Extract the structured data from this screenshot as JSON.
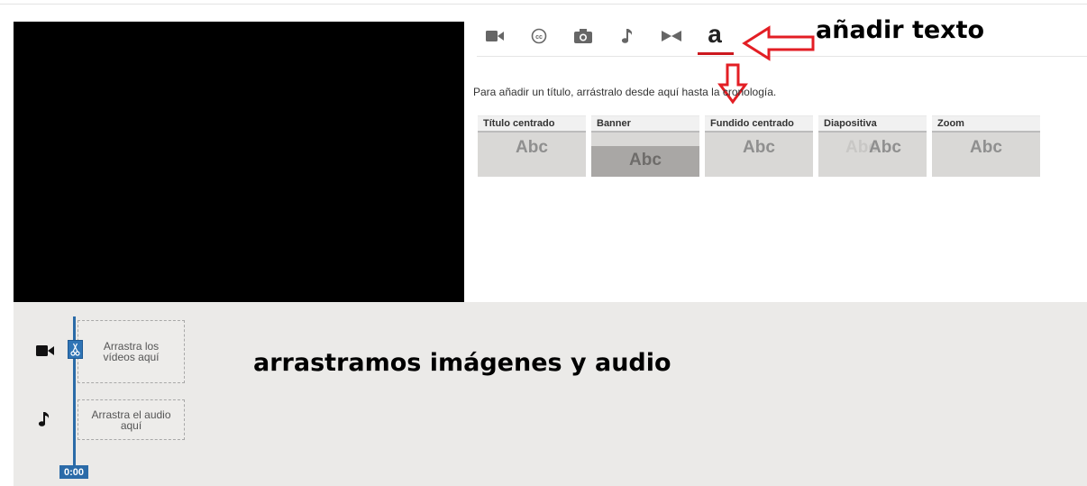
{
  "editor": {
    "tabs": [
      {
        "name": "video-camera-icon"
      },
      {
        "name": "closed-captions-icon"
      },
      {
        "name": "photo-camera-icon"
      },
      {
        "name": "music-note-icon"
      },
      {
        "name": "transitions-icon"
      },
      {
        "name": "text-tab",
        "label": "a"
      }
    ],
    "instruction": "Para añadir un título, arrástralo desde aquí hasta la cronología.",
    "title_styles": [
      {
        "label": "Título centrado",
        "sample": "Abc"
      },
      {
        "label": "Banner",
        "sample": "Abc"
      },
      {
        "label": "Fundido centrado",
        "sample": "Abc"
      },
      {
        "label": "Diapositiva",
        "sample": "Abc"
      },
      {
        "label": "Zoom",
        "sample": "Abc"
      }
    ]
  },
  "timeline": {
    "video_drop": "Arrastra los vídeos aquí",
    "audio_drop": "Arrastra el audio aquí",
    "time": "0:00"
  },
  "annotations": {
    "add_text": "añadir texto",
    "drag_hint": "arrastramos imágenes y audio"
  },
  "colors": {
    "accent_red": "#cc181e",
    "playhead_blue": "#2b6ba8",
    "annotation_arrow": "#e31e24"
  }
}
